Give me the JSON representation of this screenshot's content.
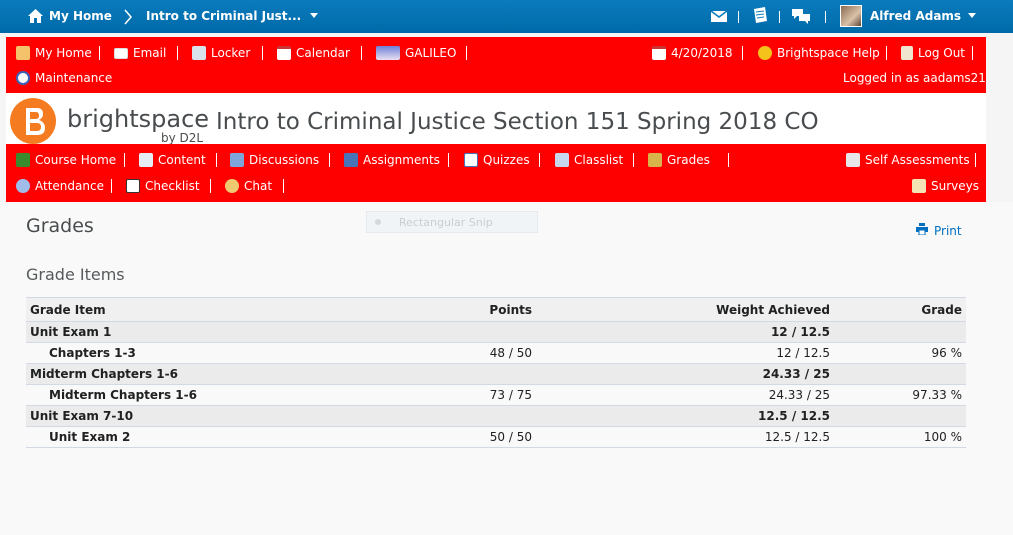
{
  "topbar": {
    "home_label": "My Home",
    "course_crumb": "Intro to Criminal Just...",
    "user_name": "Alfred Adams",
    "icons": [
      "home-icon",
      "mail-icon",
      "notes-icon",
      "chat-bubbles-icon",
      "avatar"
    ]
  },
  "navbar1": {
    "left": [
      {
        "label": "My Home",
        "icon": "home-icon"
      },
      {
        "label": "Email",
        "icon": "email-icon"
      },
      {
        "label": "Locker",
        "icon": "locker-icon"
      },
      {
        "label": "Calendar",
        "icon": "calendar-icon"
      },
      {
        "label": "GALILEO",
        "icon": "galileo-icon"
      }
    ],
    "right": [
      {
        "label": "4/20/2018",
        "icon": "calendar-icon"
      },
      {
        "label": "Brightspace Help",
        "icon": "help-icon"
      },
      {
        "label": "Log Out",
        "icon": "logout-icon"
      }
    ],
    "row2_left": {
      "label": "Maintenance",
      "icon": "maintenance-icon"
    },
    "logged_in": "Logged in as aadams21"
  },
  "brand": {
    "name": "brightspace",
    "sub": "by D2L",
    "course_title": "Intro to Criminal Justice Section 151 Spring 2018 CO"
  },
  "navbar2": {
    "row1_left": [
      {
        "label": "Course Home",
        "icon": "book-icon"
      },
      {
        "label": "Content",
        "icon": "content-icon"
      },
      {
        "label": "Discussions",
        "icon": "discussions-icon"
      },
      {
        "label": "Assignments",
        "icon": "assignments-icon"
      },
      {
        "label": "Quizzes",
        "icon": "quizzes-icon"
      },
      {
        "label": "Classlist",
        "icon": "classlist-icon"
      },
      {
        "label": "Grades",
        "icon": "grades-icon"
      }
    ],
    "row1_right": {
      "label": "Self Assessments",
      "icon": "self-assessment-icon"
    },
    "row2_left": [
      {
        "label": "Attendance",
        "icon": "attendance-icon"
      },
      {
        "label": "Checklist",
        "icon": "checklist-icon"
      },
      {
        "label": "Chat",
        "icon": "chat-icon"
      }
    ],
    "row2_right": {
      "label": "Surveys",
      "icon": "surveys-icon"
    }
  },
  "page": {
    "title": "Grades",
    "print_label": "Print",
    "section_title": "Grade Items",
    "snip_label": "Rectangular Snip"
  },
  "grades": {
    "columns": [
      "Grade Item",
      "Points",
      "Weight Achieved",
      "Grade"
    ],
    "rows": [
      {
        "type": "category",
        "name": "Unit Exam 1",
        "points": "",
        "weight": "12 / 12.5",
        "grade": ""
      },
      {
        "type": "item",
        "name": "Chapters 1-3",
        "points": "48 / 50",
        "weight": "12 / 12.5",
        "grade": "96 %"
      },
      {
        "type": "category",
        "name": "Midterm Chapters 1-6",
        "points": "",
        "weight": "24.33 / 25",
        "grade": ""
      },
      {
        "type": "item",
        "name": "Midterm Chapters 1-6",
        "points": "73 / 75",
        "weight": "24.33 / 25",
        "grade": "97.33 %"
      },
      {
        "type": "category",
        "name": "Unit Exam 7-10",
        "points": "",
        "weight": "12.5 / 12.5",
        "grade": ""
      },
      {
        "type": "item",
        "name": "Unit Exam 2",
        "points": "50 / 50",
        "weight": "12.5 / 12.5",
        "grade": "100 %"
      }
    ]
  },
  "colors": {
    "topbar": "#0a7bbd",
    "navbar": "#ff0000",
    "logo_orange": "#f47b20",
    "link": "#006fbf"
  }
}
